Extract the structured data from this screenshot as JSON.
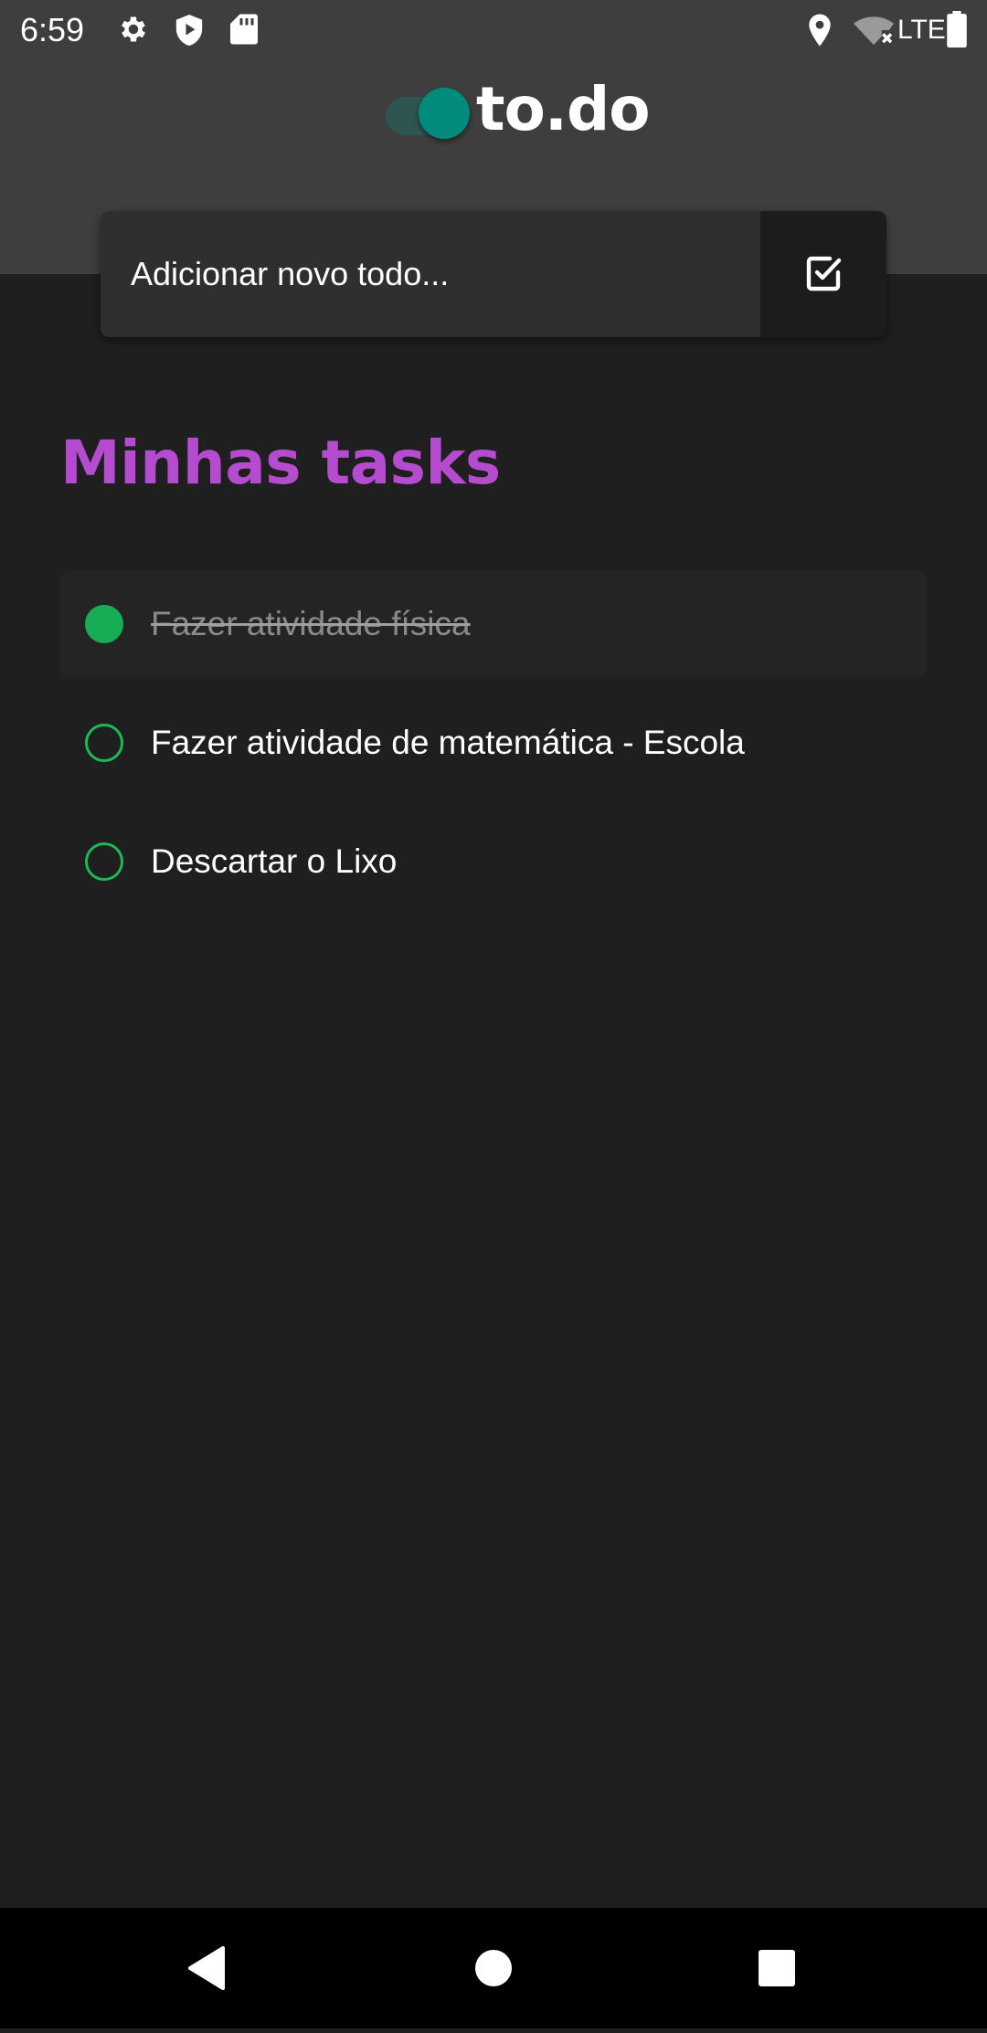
{
  "status_bar": {
    "time": "6:59",
    "network_label": "LTE",
    "left_icons": [
      "gear-icon",
      "shield-play-icon",
      "sd-card-icon"
    ],
    "right_icons": [
      "location-pin-icon",
      "wifi-off-icon",
      "battery-icon"
    ]
  },
  "header": {
    "logo_text": "to.do",
    "logo_colors": {
      "knob": "#008b7a",
      "track": "#2f5552",
      "background": "#3e3e3e"
    }
  },
  "add_todo": {
    "placeholder": "Adicionar novo todo...",
    "value": "",
    "button_icon": "checkbox-check-icon"
  },
  "tasks_section": {
    "title": "Minhas tasks",
    "title_color": "#b54ccf",
    "items": [
      {
        "label": "Fazer atividade física",
        "done": true
      },
      {
        "label": "Fazer atividade de matemática - Escola",
        "done": false
      },
      {
        "label": "Descartar o Lixo",
        "done": false
      }
    ],
    "check_color": "#17ad55"
  },
  "nav_bar": {
    "buttons": [
      "back-triangle-icon",
      "home-circle-icon",
      "recents-square-icon"
    ]
  }
}
